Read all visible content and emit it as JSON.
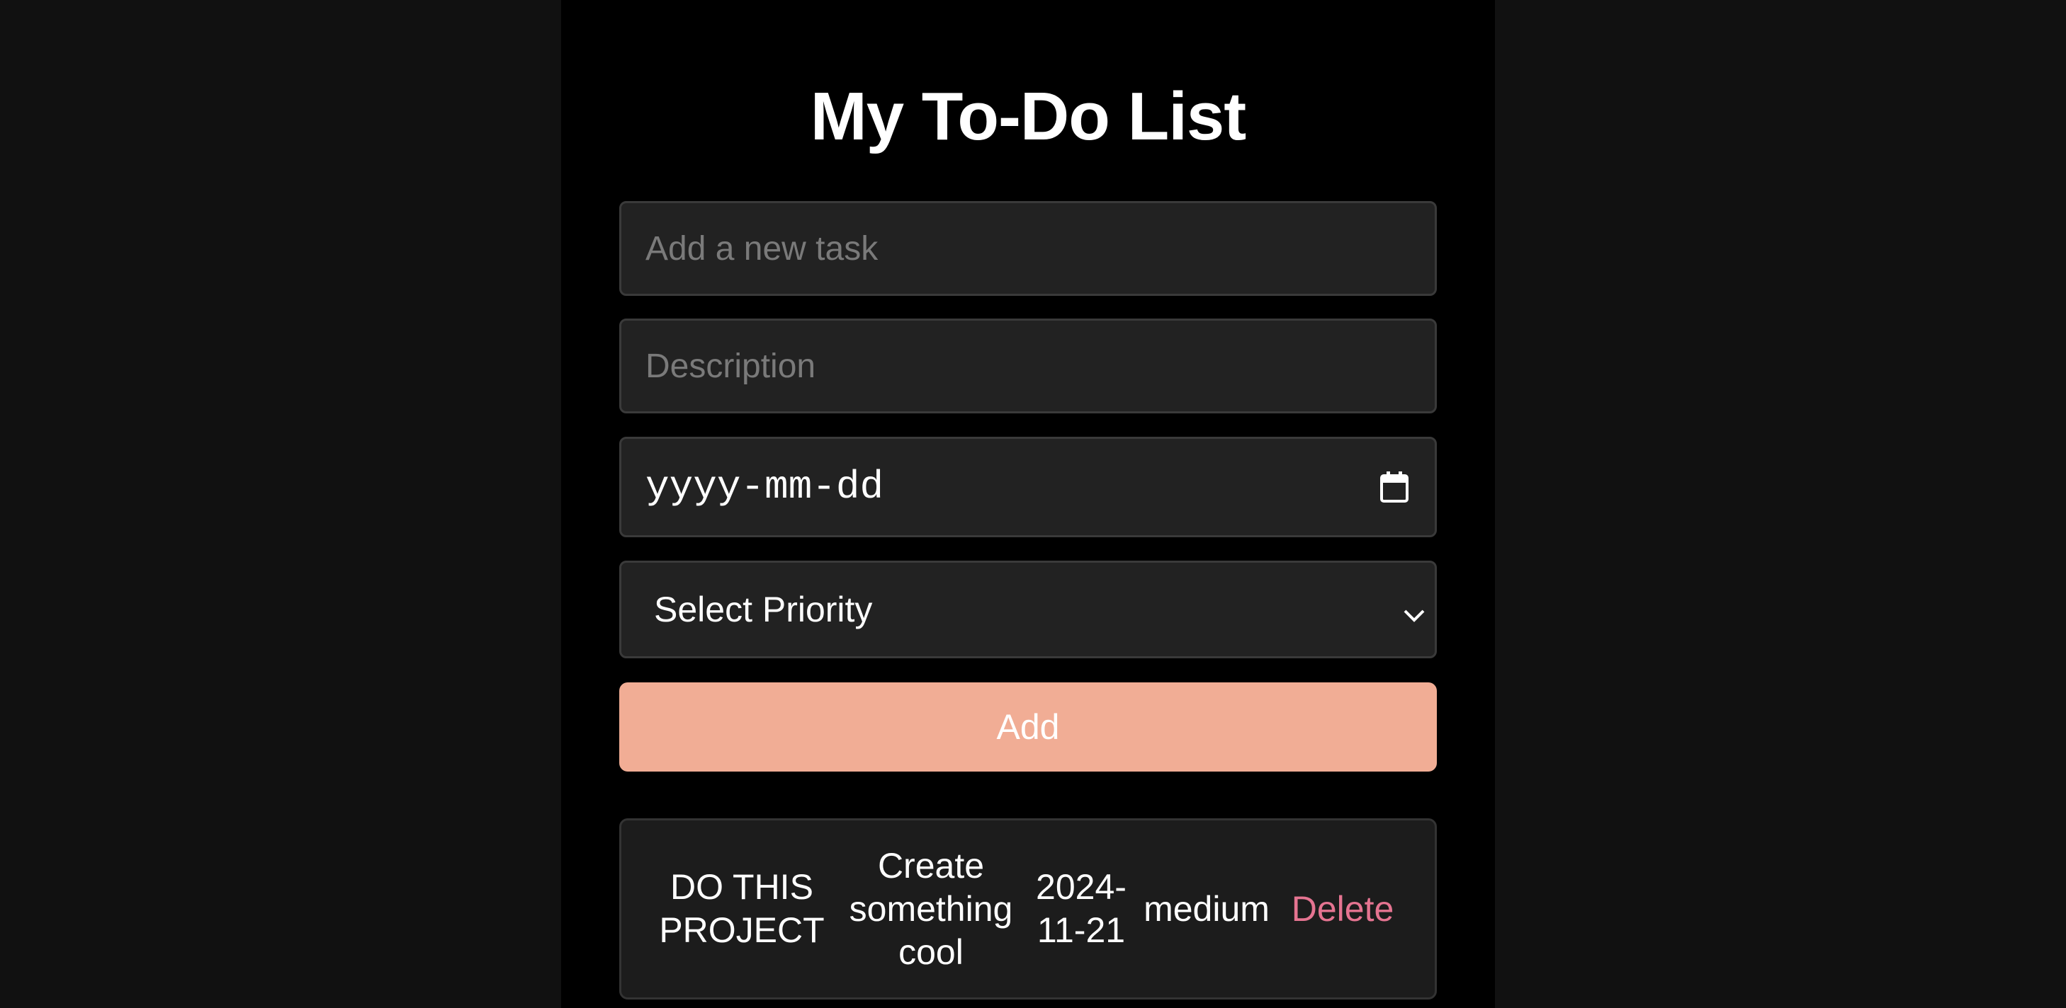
{
  "header": {
    "title": "My To-Do List"
  },
  "form": {
    "task_placeholder": "Add a new task",
    "description_placeholder": "Description",
    "date_placeholder": "yyyy-mm-dd",
    "priority_selected": "Select Priority",
    "add_label": "Add"
  },
  "tasks": [
    {
      "title": "DO THIS PROJECT",
      "description": "Create something cool",
      "date": "2024-11-21",
      "priority": "medium",
      "delete_label": "Delete"
    }
  ],
  "colors": {
    "page_background": "#111111",
    "app_background": "#000000",
    "field_background": "#222222",
    "add_button": "#f1ad95",
    "delete_text": "#e57491"
  },
  "icons": {
    "date_picker": "calendar-icon",
    "select": "chevron-down-icon"
  }
}
